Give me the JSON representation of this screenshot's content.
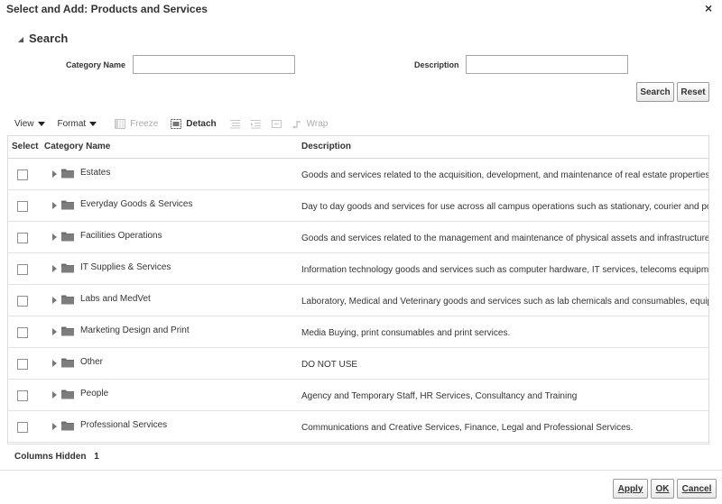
{
  "dialog": {
    "title": "Select and Add: Products and Services",
    "close_glyph": "×"
  },
  "search": {
    "title": "Search",
    "category_label": "Category Name",
    "category_value": "",
    "description_label": "Description",
    "description_value": "",
    "search_button": "Search",
    "reset_button": "Reset"
  },
  "toolbar": {
    "view": "View",
    "format": "Format",
    "freeze": "Freeze",
    "detach": "Detach",
    "wrap": "Wrap"
  },
  "table": {
    "headers": {
      "select": "Select",
      "category": "Category Name",
      "description": "Description"
    },
    "rows": [
      {
        "name": "Estates",
        "description": "Goods and services related to the acquisition, development, and maintenance of real estate properties, such"
      },
      {
        "name": "Everyday Goods & Services",
        "description": "Day to day goods and services for use across all campus operations such as stationary, courier and postal se"
      },
      {
        "name": "Facilities Operations",
        "description": "Goods and services related to the management and maintenance of physical assets and infrastructure within"
      },
      {
        "name": "IT Supplies & Services",
        "description": "Information technology goods and services such as computer hardware, IT services, telecoms equipment an"
      },
      {
        "name": "Labs and MedVet",
        "description": "Laboratory, Medical and Veterinary goods and services such as lab chemicals and consumables, equipment"
      },
      {
        "name": "Marketing Design and Print",
        "description": "Media Buying, print consumables and print services."
      },
      {
        "name": "Other",
        "description": "DO NOT USE"
      },
      {
        "name": "People",
        "description": "Agency and Temporary Staff, HR Services, Consultancy and Training"
      },
      {
        "name": "Professional Services",
        "description": "Communications and Creative Services, Finance, Legal and Professional Services."
      }
    ]
  },
  "footer": {
    "columns_hidden_label": "Columns Hidden",
    "columns_hidden_count": "1",
    "apply_button": "Apply",
    "ok_button": "OK",
    "cancel_button": "Cancel"
  }
}
